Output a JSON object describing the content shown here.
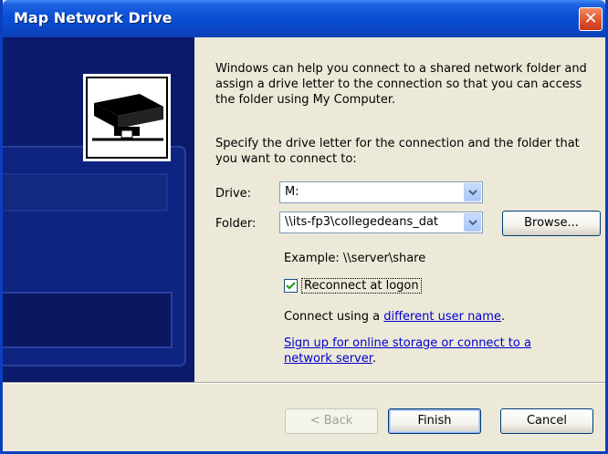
{
  "window": {
    "title": "Map Network Drive",
    "close_glyph": "✕"
  },
  "intro_text": "Windows can help you connect to a shared network folder and assign a drive letter to the connection so that you can access the folder using My Computer.",
  "specify_text": "Specify the drive letter for the connection and the folder that you want to connect to:",
  "drive": {
    "label": "Drive:",
    "value": "M:"
  },
  "folder": {
    "label": "Folder:",
    "value": "\\\\its-fp3\\collegedeans_dat",
    "browse_label": "Browse..."
  },
  "example_text": "Example: \\\\server\\share",
  "reconnect": {
    "label": "Reconnect at logon",
    "checked": true
  },
  "connect_using": {
    "prefix": "Connect using a ",
    "link": "different user name",
    "suffix": "."
  },
  "signup": {
    "link_line1": "Sign up for online storage or connect to a",
    "link_line2": "network server",
    "suffix": "."
  },
  "buttons": {
    "back": "< Back",
    "finish": "Finish",
    "cancel": "Cancel"
  },
  "icons": {
    "close": "close-icon",
    "network_drive": "network-drive-icon",
    "dropdown": "chevron-down-icon",
    "checkmark": "checkmark-icon"
  }
}
